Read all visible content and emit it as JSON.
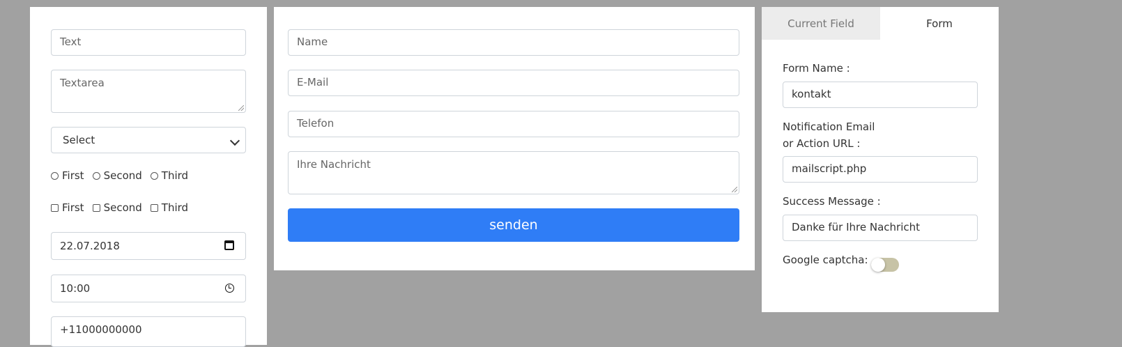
{
  "palette": {
    "text_placeholder": "Text",
    "textarea_placeholder": "Textarea",
    "select_value": "Select",
    "radios": [
      "First",
      "Second",
      "Third"
    ],
    "checkboxes": [
      "First",
      "Second",
      "Third"
    ],
    "date_value": "22.07.2018",
    "time_value": "10:00",
    "phone_value": "+11000000000"
  },
  "canvas": {
    "name_placeholder": "Name",
    "email_placeholder": "E-Mail",
    "phone_placeholder": "Telefon",
    "message_placeholder": "Ihre Nachricht",
    "submit_label": "senden"
  },
  "settings": {
    "tabs": [
      "Current Field",
      "Form"
    ],
    "active_tab": "Form",
    "form_name_label": "Form Name :",
    "form_name_value": "kontakt",
    "notification_label_line1": "Notification Email",
    "notification_label_line2": "or Action URL :",
    "notification_value": "mailscript.php",
    "success_label": "Success Message :",
    "success_value": "Danke für Ihre Nachricht",
    "captcha_label": "Google captcha:",
    "captcha_enabled": false
  },
  "colors": {
    "background": "#a1a1a1",
    "accent": "#2f7df6",
    "toggle_off": "#c7c3a6"
  }
}
